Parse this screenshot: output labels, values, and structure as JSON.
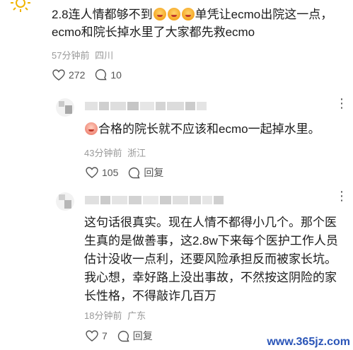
{
  "comment1": {
    "line1": "2.8连人情都够不到",
    "line1b": "单凭让ecmo出院这一点，",
    "line2": "ecmo和院长掉水里了大家都先救ecmo",
    "time": "57分钟前",
    "location": "四川",
    "likes": "272",
    "replies": "10"
  },
  "comment2": {
    "text": "合格的院长就不应该和ecmo一起掉水里。",
    "time": "43分钟前",
    "location": "浙江",
    "likes": "105",
    "reply_label": "回复"
  },
  "comment3": {
    "line1": "这句话很真实。现在人情不都得小几个。那个医",
    "line2": "生真的是做善事，这2.8w下来每个医护工作人员",
    "line3": "估计没收一点利，还要风险承担反而被家长坑。",
    "line4": "我心想，幸好路上没出事故，不然按这阴险的家",
    "line5": "长性格，不得敲诈几百万",
    "time": "18分钟前",
    "location": "广东",
    "likes": "7",
    "reply_label": "回复"
  },
  "watermark": "www.365jz.com",
  "icons": [
    "sun-avatar-icon",
    "heart-icon",
    "comment-icon",
    "more-dots-icon"
  ]
}
